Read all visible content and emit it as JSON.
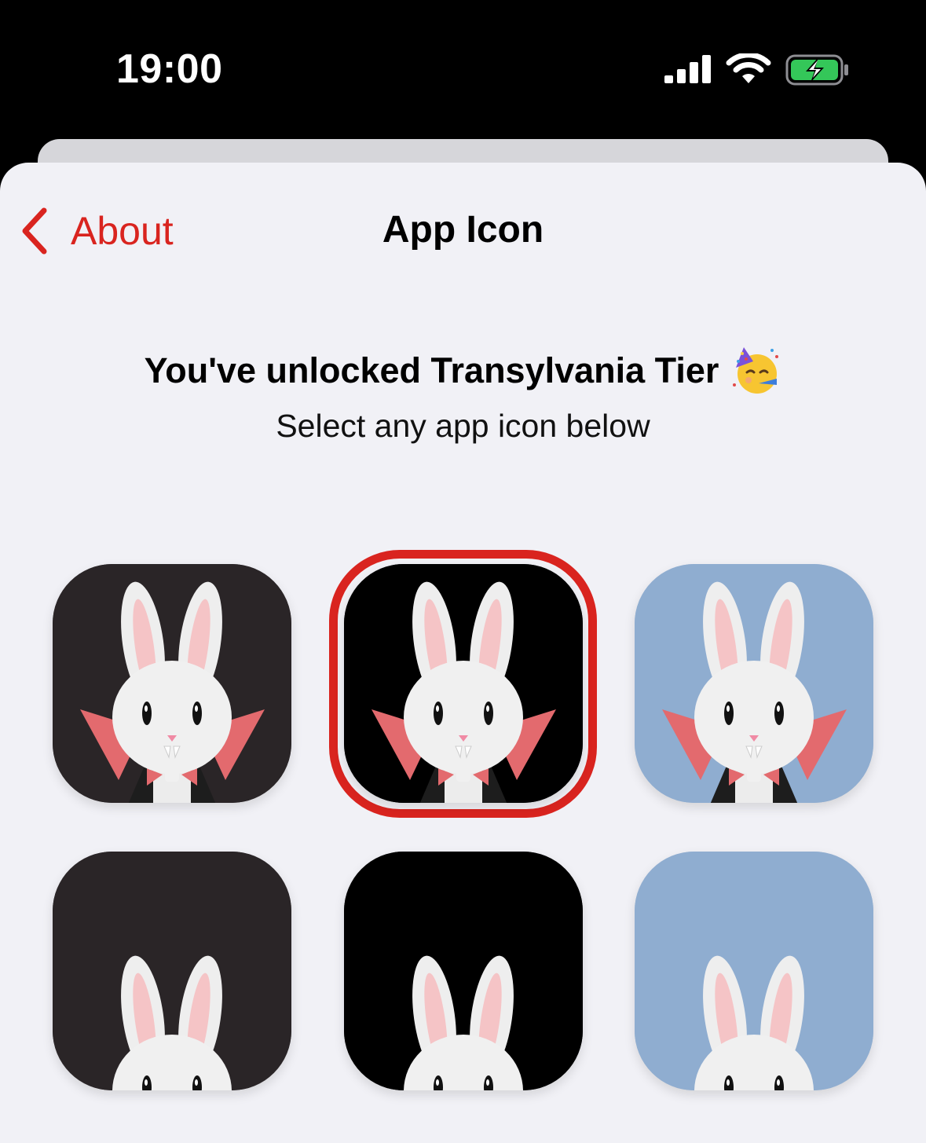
{
  "status_bar": {
    "time": "19:00"
  },
  "nav": {
    "back_label": "About",
    "title": "App Icon"
  },
  "content": {
    "headline": "You've unlocked Transylvania Tier",
    "subline": "Select any app icon below"
  },
  "icons": [
    {
      "name": "Dark",
      "background": "#2a2527",
      "selected": false
    },
    {
      "name": "Black",
      "background": "#000000",
      "selected": true
    },
    {
      "name": "Blue",
      "background": "#8fadd0",
      "selected": false
    },
    {
      "name": "Dark",
      "background": "#2a2527",
      "selected": false
    },
    {
      "name": "Black",
      "background": "#000000",
      "selected": false
    },
    {
      "name": "Blue",
      "background": "#8fadd0",
      "selected": false
    }
  ],
  "colors": {
    "accent": "#d9241f",
    "sheet_background": "#f1f1f6"
  }
}
